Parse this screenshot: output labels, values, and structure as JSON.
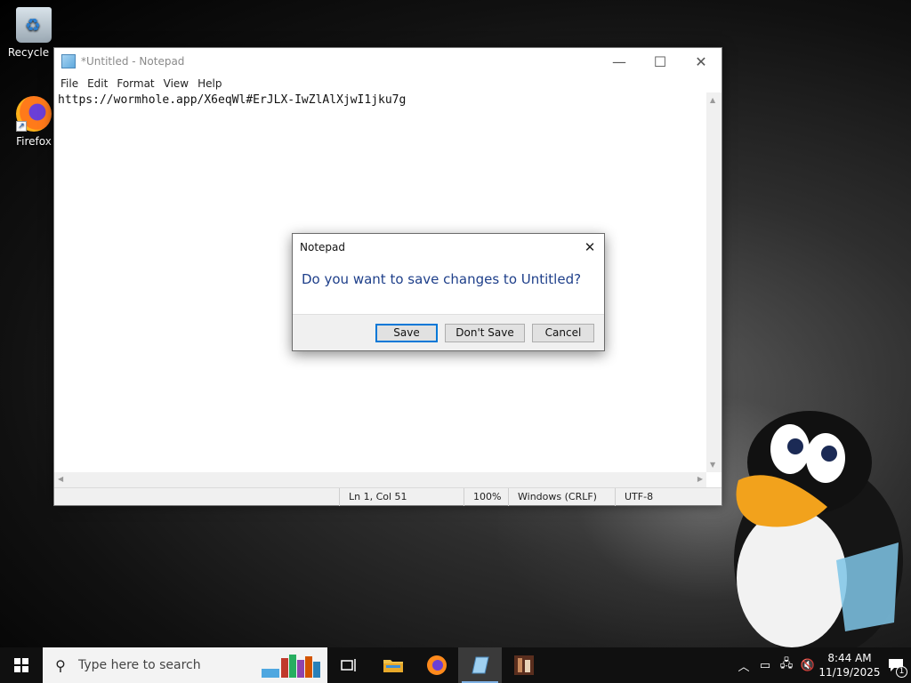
{
  "desktop": {
    "icons": [
      {
        "label": "Recycle B",
        "icon": "recycle-bin-icon"
      },
      {
        "label": "Firefox",
        "icon": "firefox-icon"
      }
    ]
  },
  "notepad": {
    "title": "*Untitled - Notepad",
    "menu": [
      "File",
      "Edit",
      "Format",
      "View",
      "Help"
    ],
    "content": "https://wormhole.app/X6eqWl#ErJLX-IwZlAlXjwI1jku7g",
    "status": {
      "position": "Ln 1, Col 51",
      "zoom": "100%",
      "line_ending": "Windows (CRLF)",
      "encoding": "UTF-8"
    }
  },
  "dialog": {
    "title": "Notepad",
    "message": "Do you want to save changes to Untitled?",
    "buttons": {
      "save": "Save",
      "dont_save": "Don't Save",
      "cancel": "Cancel"
    }
  },
  "taskbar": {
    "search_placeholder": "Type here to search",
    "pinned": [
      "task-view-icon",
      "file-explorer-icon",
      "firefox-icon",
      "notepad-icon",
      "media-app-icon"
    ],
    "active": "notepad-icon",
    "clock": {
      "time": "8:44 AM",
      "date": "11/19/2025"
    },
    "notification_count": "1"
  },
  "colors": {
    "accent": "#0078d7",
    "dialog_message": "#1e3f8a",
    "taskbar": "#101010"
  }
}
